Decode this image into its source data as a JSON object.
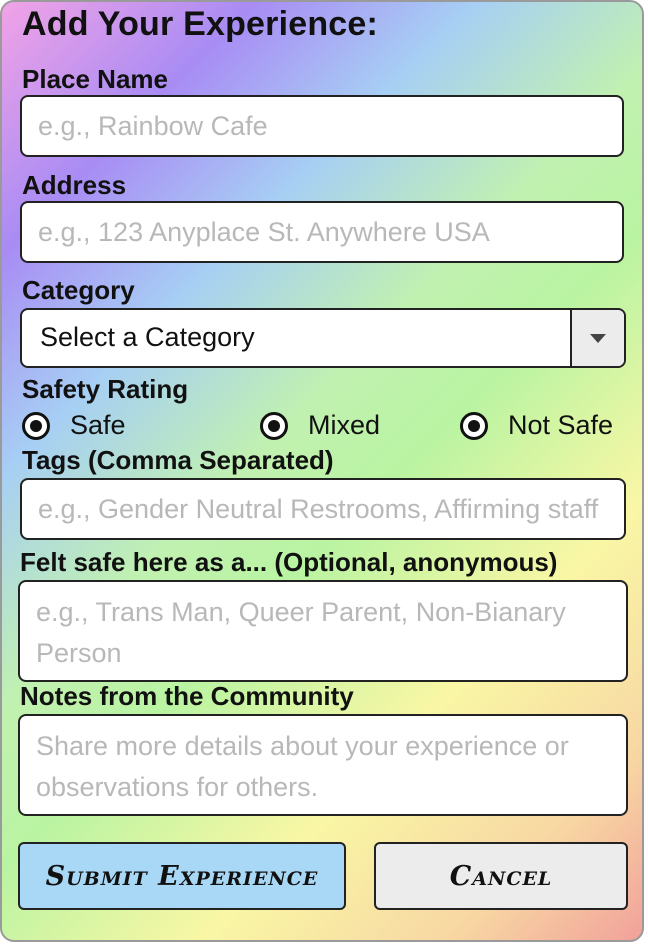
{
  "form": {
    "title": "Add Your Experience:",
    "place_name": {
      "label": "Place Name",
      "placeholder": "e.g., Rainbow Cafe",
      "value": ""
    },
    "address": {
      "label": "Address",
      "placeholder": "e.g., 123 Anyplace St. Anywhere USA",
      "value": ""
    },
    "category": {
      "label": "Category",
      "selected": "Select a Category",
      "icon": "chevron-down-icon"
    },
    "safety_rating": {
      "label": "Safety Rating",
      "options": [
        "Safe",
        "Mixed",
        "Not Safe"
      ]
    },
    "tags": {
      "label": "Tags (Comma Separated)",
      "placeholder": "e.g., Gender Neutral Restrooms, Affirming staff",
      "value": ""
    },
    "identity": {
      "label": "Felt safe here as a... (Optional, anonymous)",
      "placeholder": "e.g., Trans Man, Queer Parent, Non-Bianary Person",
      "value": ""
    },
    "notes": {
      "label": "Notes from the Community",
      "placeholder": "Share more details about your experience or observations for others.",
      "value": ""
    },
    "buttons": {
      "submit": "Submit Experience",
      "cancel": "Cancel"
    }
  },
  "colors": {
    "submit_bg": "#a9d8f6",
    "cancel_bg": "#ececec",
    "border": "#222222",
    "gradient": [
      "#f2a3e6",
      "#a88cf4",
      "#a7cff4",
      "#c1f1b0",
      "#f9f7a5",
      "#f1a19a"
    ]
  }
}
